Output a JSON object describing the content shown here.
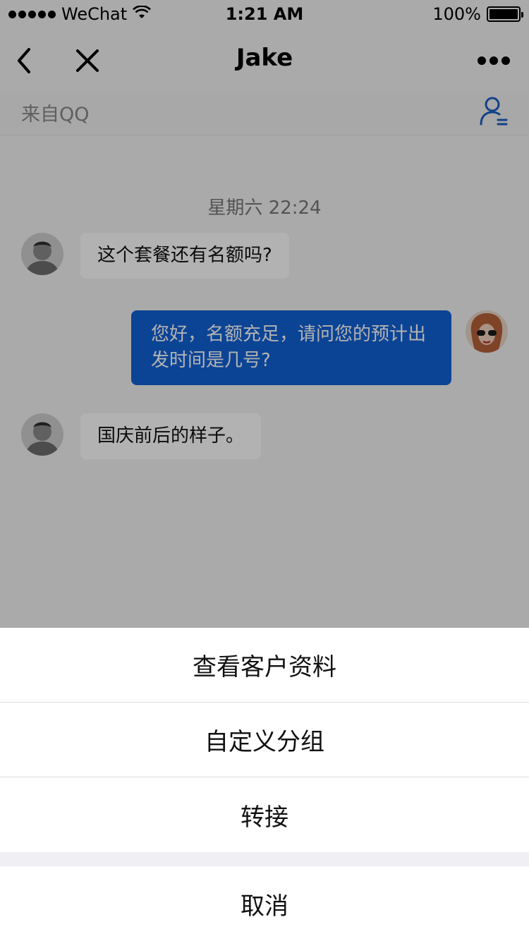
{
  "status_bar": {
    "carrier": "WeChat",
    "time": "1:21 AM",
    "battery": "100%",
    "signal_icon": "signal-dots-icon",
    "wifi_icon": "wifi-icon",
    "battery_icon": "battery-icon",
    "battery_level": 1.0
  },
  "nav": {
    "title": "Jake",
    "back_icon": "chevron-left-icon",
    "close_icon": "close-icon",
    "more_icon": "more-dots-icon"
  },
  "subbar": {
    "source_label": "来自QQ",
    "contact_icon": "contact-profile-icon",
    "accent_color": "#1a5fc4"
  },
  "chat": {
    "timestamp": "星期六   22:24",
    "messages": [
      {
        "side": "in",
        "text": "这个套餐还有名额吗?"
      },
      {
        "side": "out",
        "text": "您好，名额充足，请问您的预计出发时间是几号?"
      },
      {
        "side": "in",
        "text": "国庆前后的样子。"
      }
    ],
    "outgoing_bubble_color": "#1262d6"
  },
  "action_sheet": {
    "items": [
      "查看客户资料",
      "自定义分组",
      "转接"
    ],
    "cancel": "取消"
  }
}
